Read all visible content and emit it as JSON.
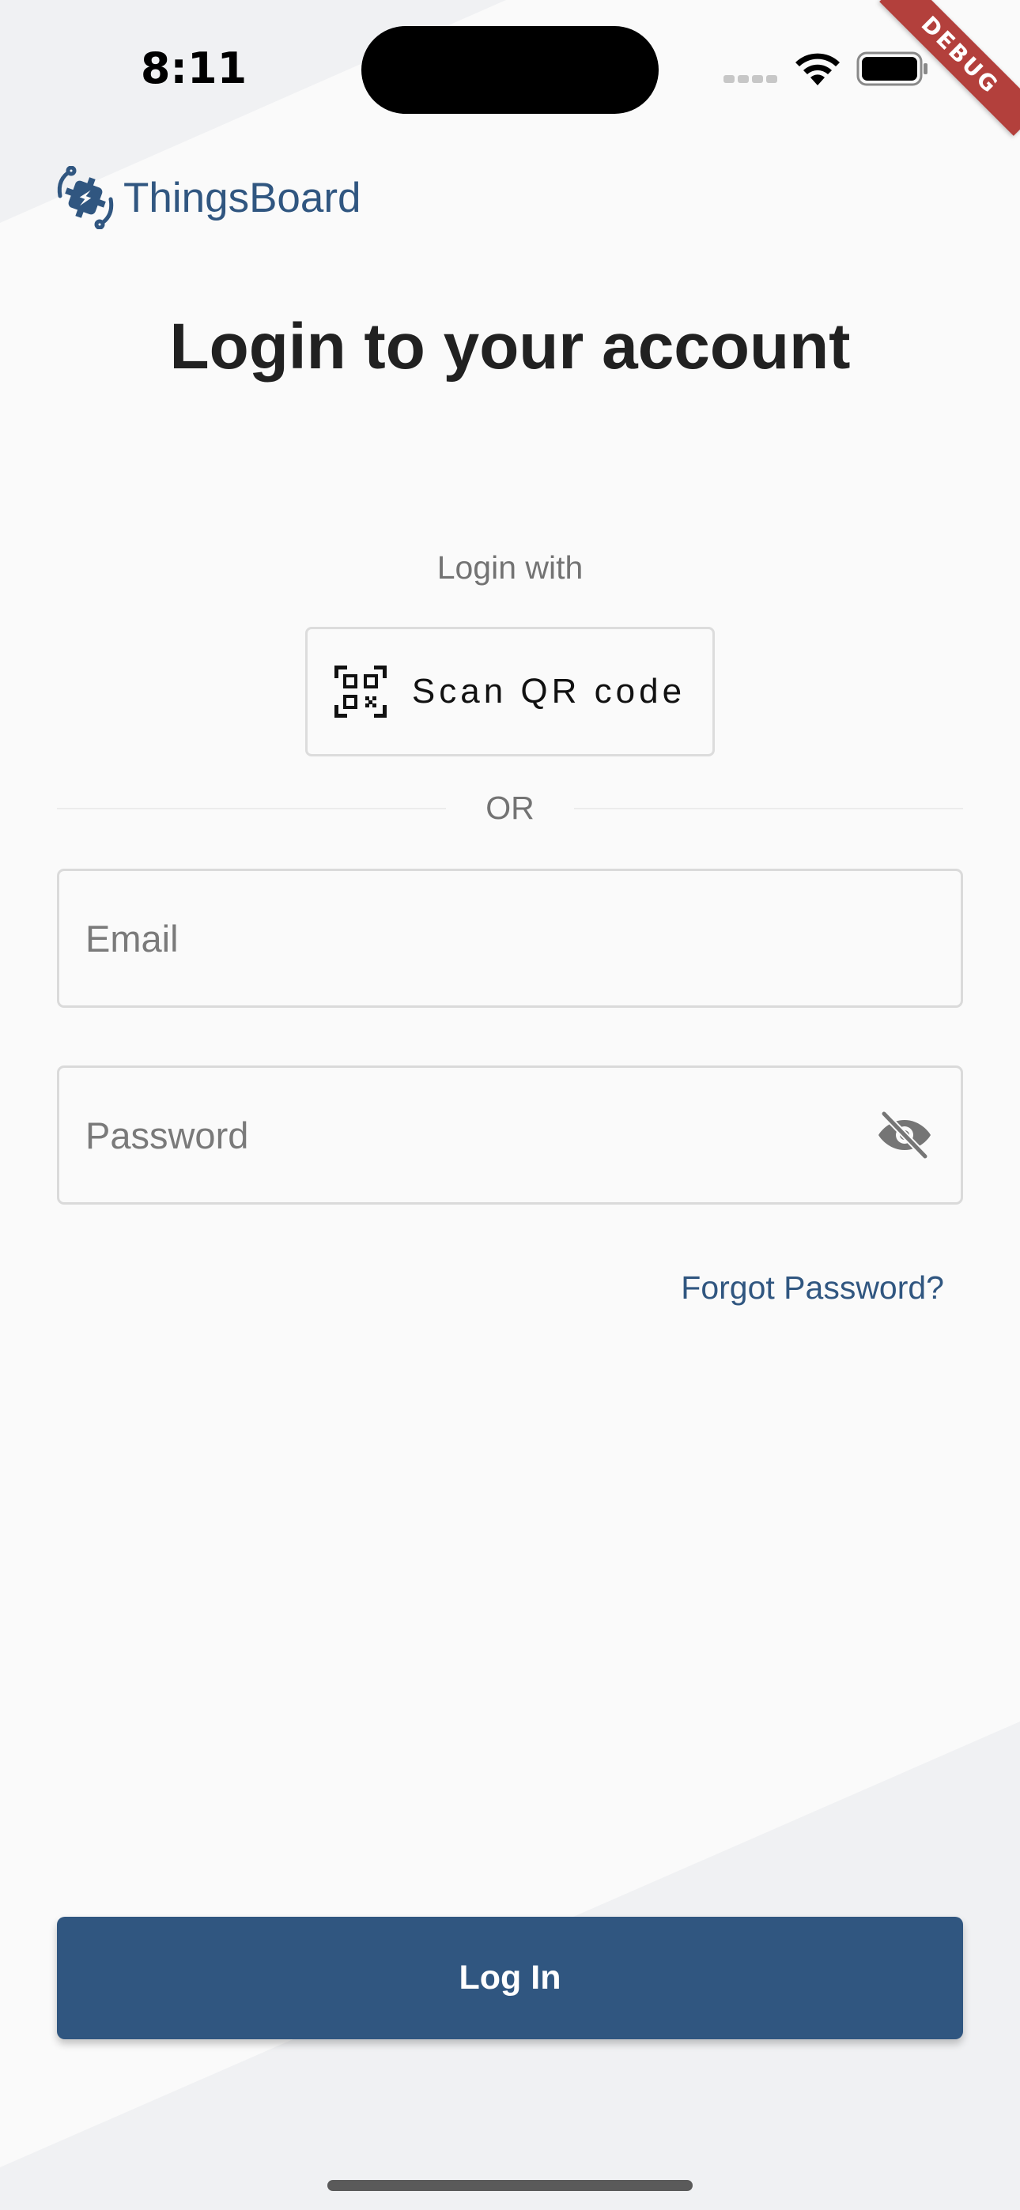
{
  "status_bar": {
    "time": "8:11",
    "icons": [
      "cellular-signal-icon",
      "wifi-icon",
      "battery-icon"
    ]
  },
  "debug_banner": "DEBUG",
  "brand": {
    "name": "ThingsBoard",
    "logo_icon": "thingsboard-logo-icon",
    "color": "#305680"
  },
  "page": {
    "title": "Login to your account",
    "login_with": "Login with",
    "scan_qr_label": "Scan QR code",
    "scan_qr_icon": "qr-code-icon",
    "or_divider": "OR"
  },
  "form": {
    "email_placeholder": "Email",
    "email_value": "",
    "password_placeholder": "Password",
    "password_value": "",
    "password_visibility_icon": "visibility-off-icon",
    "forgot_password": "Forgot Password?",
    "login_button": "Log In"
  },
  "colors": {
    "primary": "#305680",
    "background": "#fafafa",
    "debug_banner": "#b3403c"
  }
}
